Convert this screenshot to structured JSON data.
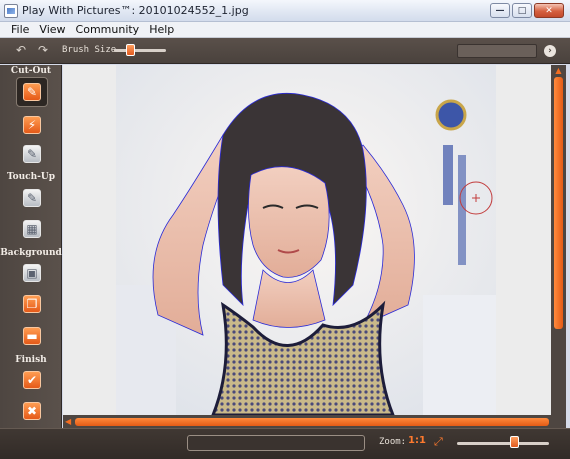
{
  "window": {
    "title": "Play With Pictures™: 20101024552_1.jpg",
    "minimize_glyph": "—",
    "maximize_glyph": "□",
    "close_glyph": "✕"
  },
  "menu": [
    "File",
    "View",
    "Community",
    "Help"
  ],
  "toolbar": {
    "undo_icon": "↶",
    "redo_icon": "↷",
    "brush_size_label": "Brush Size",
    "brush_size_value_pct": 30,
    "go_icon": "›"
  },
  "sidebar": {
    "sections": [
      {
        "label": "Cut-Out",
        "tools": [
          {
            "name": "cutout-brush-icon",
            "style": "orange",
            "glyph": "✎",
            "selected": true
          },
          {
            "name": "cutout-erase-icon",
            "style": "orange",
            "glyph": "⚡",
            "selected": false
          },
          {
            "name": "cutout-refine-icon",
            "style": "gray",
            "glyph": "✎",
            "selected": false
          }
        ]
      },
      {
        "label": "Touch-Up",
        "tools": [
          {
            "name": "touchup-brush-icon",
            "style": "gray",
            "glyph": "✎",
            "selected": false
          },
          {
            "name": "touchup-layers-icon",
            "style": "gray",
            "glyph": "▦",
            "selected": false
          }
        ]
      },
      {
        "label": "Background",
        "tools": [
          {
            "name": "background-image-icon",
            "style": "gray",
            "glyph": "▣",
            "selected": false
          },
          {
            "name": "background-stack-icon",
            "style": "orange",
            "glyph": "❐",
            "selected": false
          },
          {
            "name": "background-color-icon",
            "style": "orange",
            "glyph": "▬",
            "selected": false
          }
        ]
      },
      {
        "label": "Finish",
        "tools": [
          {
            "name": "finish-accept-icon",
            "style": "orange",
            "glyph": "✔",
            "selected": false
          },
          {
            "name": "finish-cancel-icon",
            "style": "orange",
            "glyph": "✖",
            "selected": false
          }
        ]
      }
    ]
  },
  "status": {
    "zoom_label": "Zoom:",
    "zoom_actual": "1:1",
    "zoom_fit_icon": "⤢",
    "zoom_level_pct": 62
  },
  "colors": {
    "accent": "#f26d21",
    "panel": "#4e4641",
    "outline": "#2b2bd6"
  }
}
